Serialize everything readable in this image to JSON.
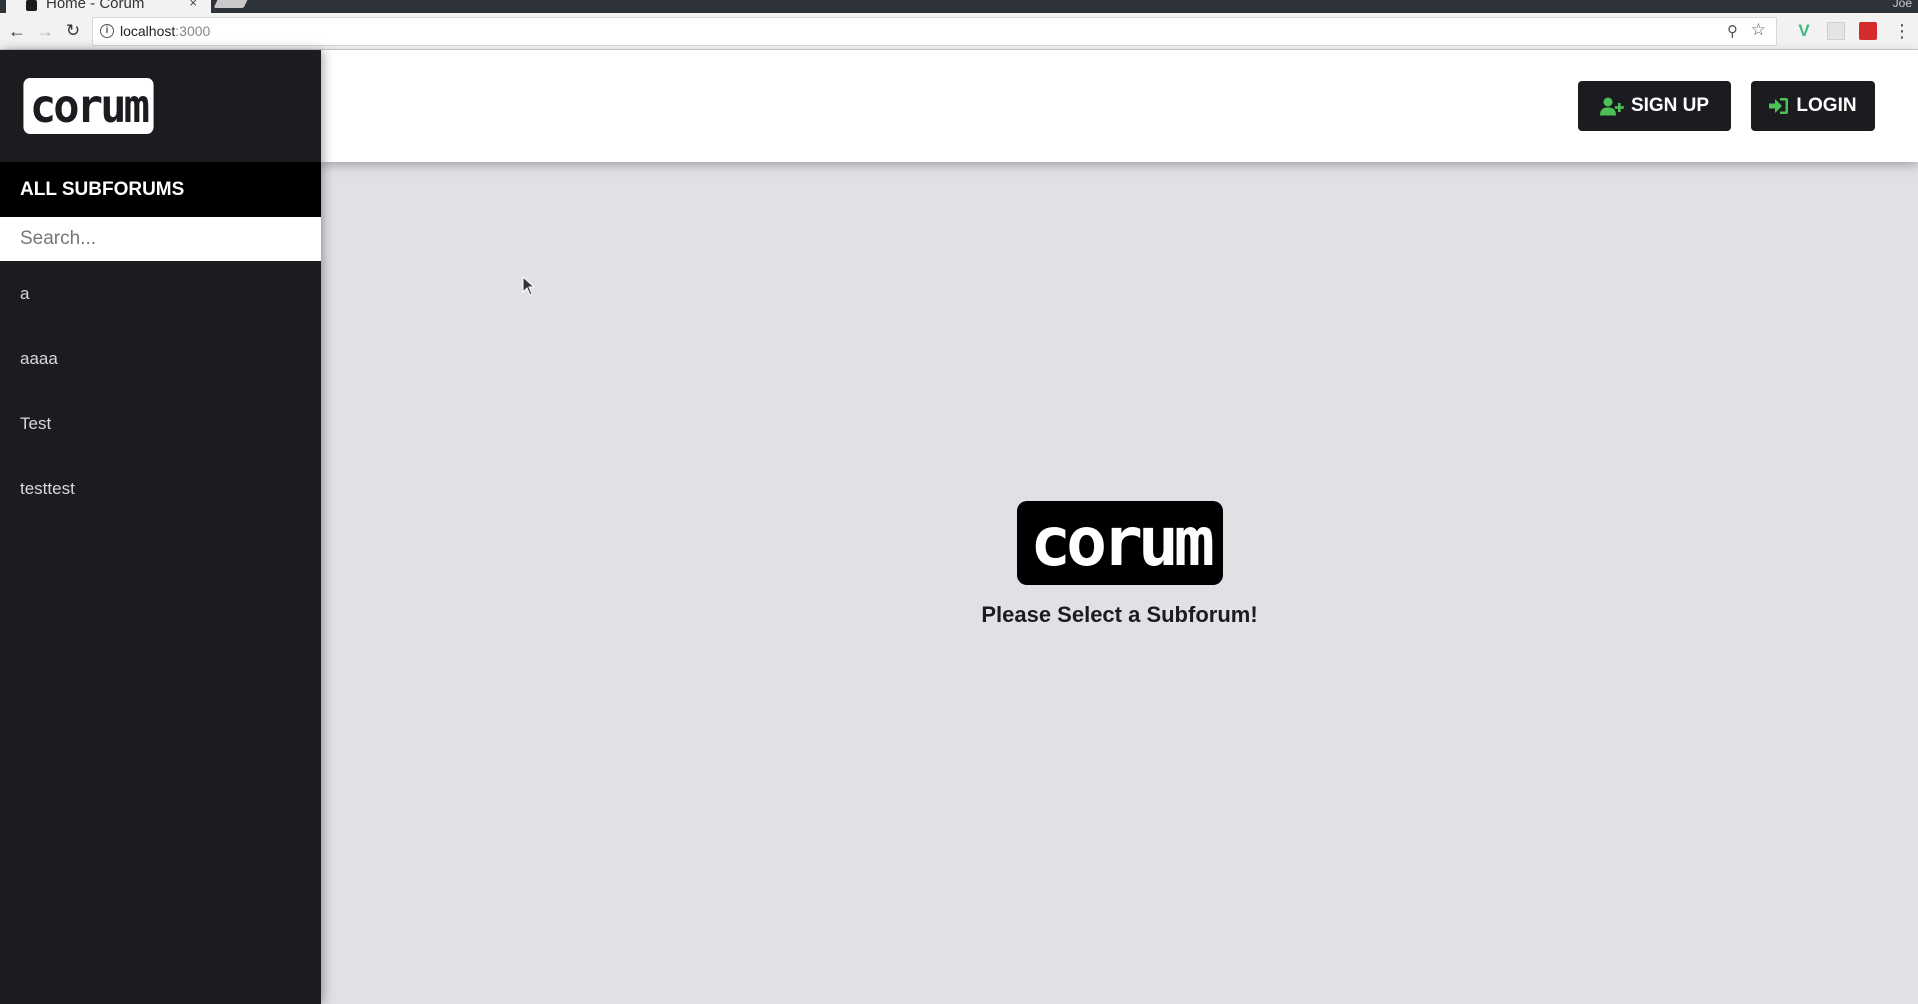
{
  "browser": {
    "tab_title": "Home - Corum",
    "tab_close": "×",
    "profile": "Joe",
    "url_host": "localhost",
    "url_port": ":3000"
  },
  "sidebar": {
    "logo_text": "corum",
    "header": "ALL SUBFORUMS",
    "search_placeholder": "Search...",
    "subforums": [
      {
        "label": "a"
      },
      {
        "label": "aaaa"
      },
      {
        "label": "Test"
      },
      {
        "label": "testtest"
      }
    ]
  },
  "topbar": {
    "signup_label": "SIGN UP",
    "login_label": "LOGIN",
    "icon_color": "#4cc157"
  },
  "main": {
    "logo_text": "corum",
    "message": "Please Select a Subforum!"
  },
  "colors": {
    "sidebar_bg": "#1b1c20",
    "main_bg": "#e0e1e5",
    "accent_green": "#4cc157"
  }
}
